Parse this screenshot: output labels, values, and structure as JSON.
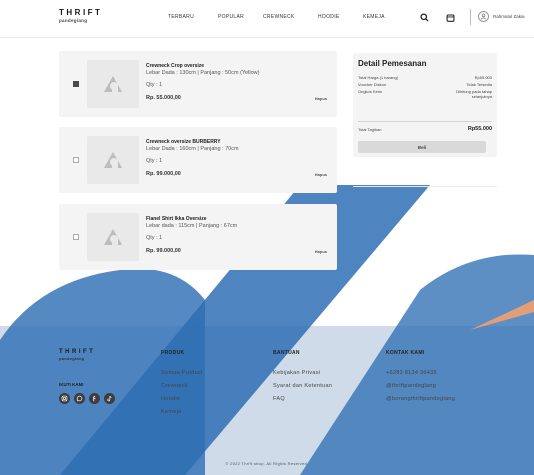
{
  "header": {
    "logo_main": "THRIFT",
    "logo_sub": "pandeglang",
    "nav": [
      "TERBARU",
      "POPULAR",
      "CREWNECK",
      "HOODIE",
      "KEMEJA"
    ],
    "user_name": "Rahmatul Zakia"
  },
  "cart": {
    "items": [
      {
        "name": "Crewneck Crop oversize",
        "size": "Lebar Dada : 130cm | Panjang : 50cm (Yellow)",
        "qty": "Qty : 1",
        "price": "Rp. 55.000,00",
        "delete_label": "Hapus",
        "checked": true
      },
      {
        "name": "Crewneck oversize BURBERRY",
        "size": "Lebar Dada : 160cm | Panjang : 70cm",
        "qty": "Qty : 1",
        "price": "Rp. 99.000,00",
        "delete_label": "Hapus",
        "checked": false
      },
      {
        "name": "Flanel Shirt Ikka Oversize",
        "size": "Lebar dada : 115cm | Panjang : 67cm",
        "qty": "Qty : 1",
        "price": "Rp. 99.000,00",
        "delete_label": "Hapus",
        "checked": false
      }
    ]
  },
  "summary": {
    "title": "Detail Pemesanan",
    "total_price_label": "Total Harga (1 barang)",
    "total_price_value": "Rp55.000",
    "voucher_label": "Voucher Diskon",
    "voucher_value": "Tidak Tersedia",
    "shipping_label": "Ongkos Kirim",
    "shipping_value_1": "Dihitung pada tahap",
    "shipping_value_2": "selanjutnya",
    "bill_label": "Total Tagihan",
    "bill_value": "Rp55.000",
    "buy_label": "Beli"
  },
  "footer": {
    "logo_main": "THRIFT",
    "logo_sub": "pandeglang",
    "follow_label": "IKUTI KAMI",
    "produk": {
      "title": "PRODUK",
      "links": [
        "Semua Product",
        "Crewneck",
        "Hoodie",
        "Kemeja"
      ]
    },
    "bantuan": {
      "title": "BANTUAN",
      "links": [
        "Kebijakan Privasi",
        "Syarat dan Ketentuan",
        "FAQ"
      ]
    },
    "kontak": {
      "title": "KONTAK KAMI",
      "links": [
        "+6283 8134 36435",
        "@thriftpandeglang",
        "@borongthriftpandeglang"
      ]
    },
    "copyright": "© 2022 Thrift shop. All Rights Reserved."
  },
  "colors": {
    "overlay_blue": "#2f6fb4",
    "accent_orange": "#f0a070",
    "panel_grey": "#f4f4f4"
  },
  "icons": [
    "search-icon",
    "bag-icon",
    "user-icon",
    "instagram-icon",
    "whatsapp-icon",
    "facebook-icon",
    "tiktok-icon"
  ]
}
